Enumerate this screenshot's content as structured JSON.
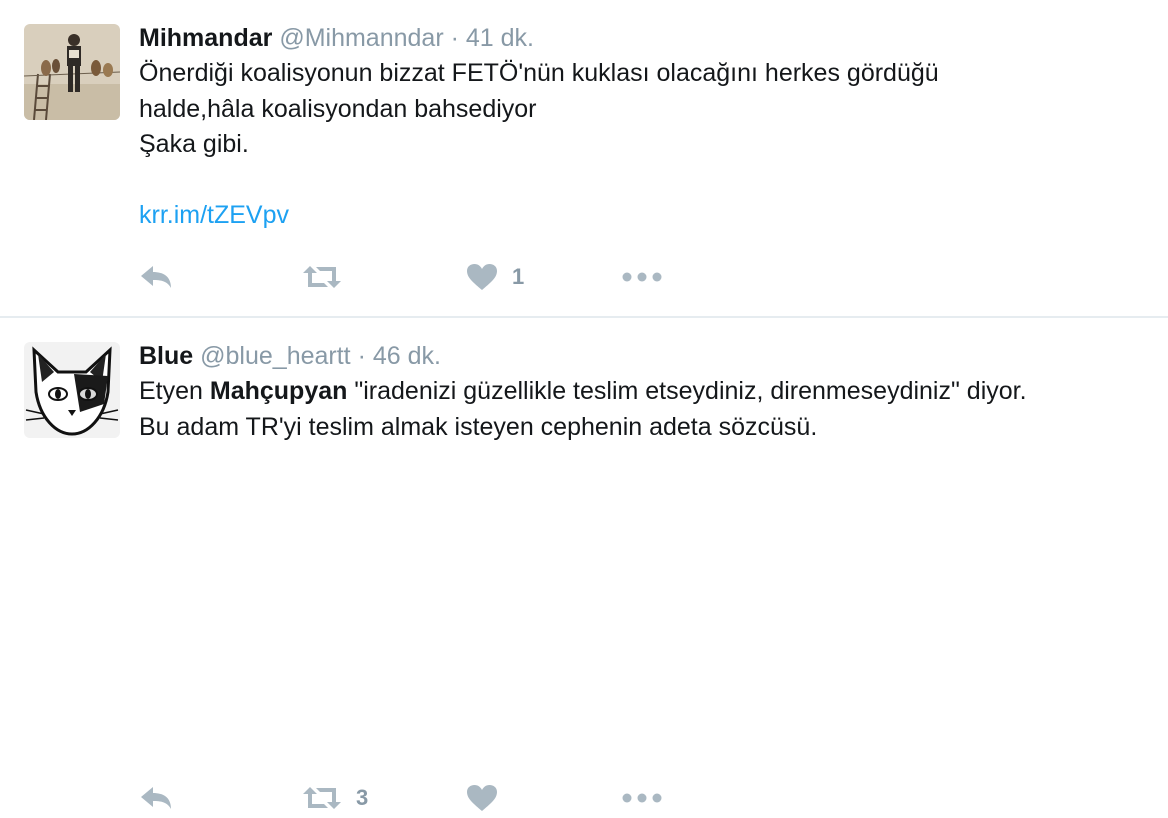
{
  "tweets": [
    {
      "name": "Mihmandar",
      "handle": "@Mihmanndar",
      "separator": "·",
      "time": "41 dk.",
      "lines": [
        "Önerdiği koalisyonun bizzat FETÖ'nün kuklası olacağını herkes gördüğü",
        "halde,hâla koalisyondan bahsediyor",
        "Şaka gibi."
      ],
      "link": "krr.im/tZEVpv",
      "like_count": "1",
      "retweet_count": ""
    },
    {
      "name": "Blue",
      "handle": "@blue_heartt",
      "separator": "·",
      "time": "46 dk.",
      "line1_pre": "Etyen ",
      "line1_bold": "Mahçupyan",
      "line1_post": " \"iradenizi güzellikle teslim etseydiniz, direnmeseydiniz\" diyor.",
      "line2": "Bu adam TR'yi teslim almak isteyen cephenin adeta sözcüsü.",
      "retweet_count": "3",
      "like_count": ""
    }
  ],
  "icons": {
    "reply": "reply-icon",
    "retweet": "retweet-icon",
    "like": "heart-icon",
    "more": "more-icon"
  },
  "colors": {
    "link": "#1da1f2",
    "muted": "#8899a6",
    "icon": "#aab8c2",
    "text": "#14171a"
  }
}
